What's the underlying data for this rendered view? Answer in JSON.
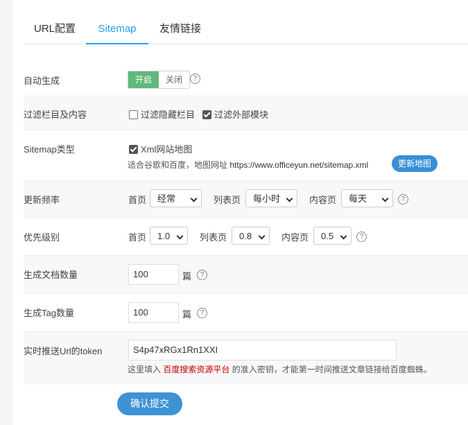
{
  "tabs": [
    {
      "label": "URL配置"
    },
    {
      "label": "Sitemap"
    },
    {
      "label": "友情链接"
    }
  ],
  "auto_generate": {
    "label": "自动生成",
    "on": "开启",
    "off": "关闭",
    "help": "?"
  },
  "filter": {
    "label": "过滤栏目及内容",
    "opt1": "过滤隐藏栏目",
    "opt2": "过滤外部模块"
  },
  "sitemap_type": {
    "label": "Sitemap类型",
    "option": "Xml网站地图",
    "note_prefix": "适合谷歌和百度，地图网址",
    "url": "https://www.officeyun.net/sitemap.xml",
    "refresh_button": "更新地图"
  },
  "frequency": {
    "label": "更新频率",
    "home_label": "首页",
    "home_value": "经常",
    "list_label": "列表页",
    "list_value": "每小时",
    "content_label": "内容页",
    "content_value": "每天"
  },
  "priority": {
    "label": "优先级别",
    "home_label": "首页",
    "home_value": "1.0",
    "list_label": "列表页",
    "list_value": "0.8",
    "content_label": "内容页",
    "content_value": "0.5"
  },
  "doc_count": {
    "label": "生成文档数量",
    "value": "100",
    "unit": "篇"
  },
  "tag_count": {
    "label": "生成Tag数量",
    "value": "100",
    "unit": "篇"
  },
  "token": {
    "label": "实时推送Url的token",
    "value": "S4p47xRGx1Rn1XXI",
    "tip_prefix": "这里填入",
    "tip_link": "百度搜索资源平台",
    "tip_suffix": "的准入密钥，才能第一时间推送文章链接给百度蜘蛛。"
  },
  "submit_label": "确认提交",
  "colors": {
    "accent": "#1e9fff",
    "switch_on": "#5fb878",
    "button": "#3d93d6",
    "link_red": "#c00000"
  }
}
